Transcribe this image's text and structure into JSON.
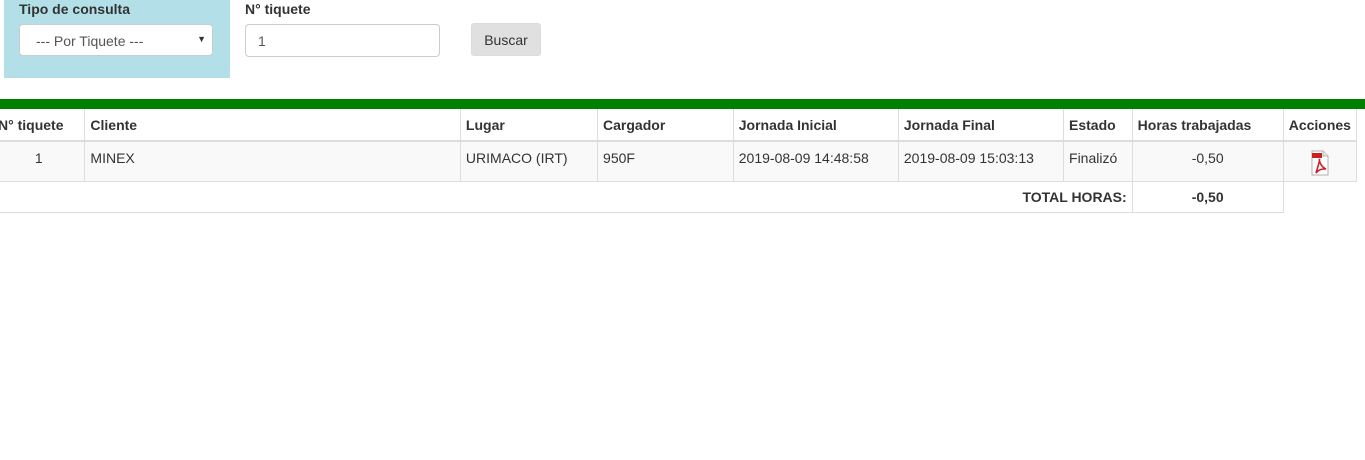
{
  "filters": {
    "tipo_label": "Tipo de consulta",
    "tipo_selected": "--- Por Tiquete ---",
    "tiquete_label": "N° tiquete",
    "tiquete_value": "1",
    "search_label": "Buscar"
  },
  "table": {
    "headers": {
      "tiquete": "N° tiquete",
      "cliente": "Cliente",
      "lugar": "Lugar",
      "cargador": "Cargador",
      "inicio": "Jornada Inicial",
      "final": "Jornada Final",
      "estado": "Estado",
      "horas": "Horas trabajadas",
      "acciones": "Acciones"
    },
    "rows": [
      {
        "tiquete": "1",
        "cliente": "MINEX",
        "lugar": "URIMACO (IRT)",
        "cargador": "950F",
        "inicio": "2019-08-09 14:48:58",
        "final": "2019-08-09 15:03:13",
        "estado": "Finalizó",
        "horas": "-0,50",
        "accion_icon": "pdf-icon"
      }
    ],
    "total_label": "TOTAL HORAS:",
    "total_value": "-0,50"
  },
  "colors": {
    "filter_bg": "#b3e0e8",
    "bar": "#008000",
    "pdf": "#cc1f1f"
  }
}
